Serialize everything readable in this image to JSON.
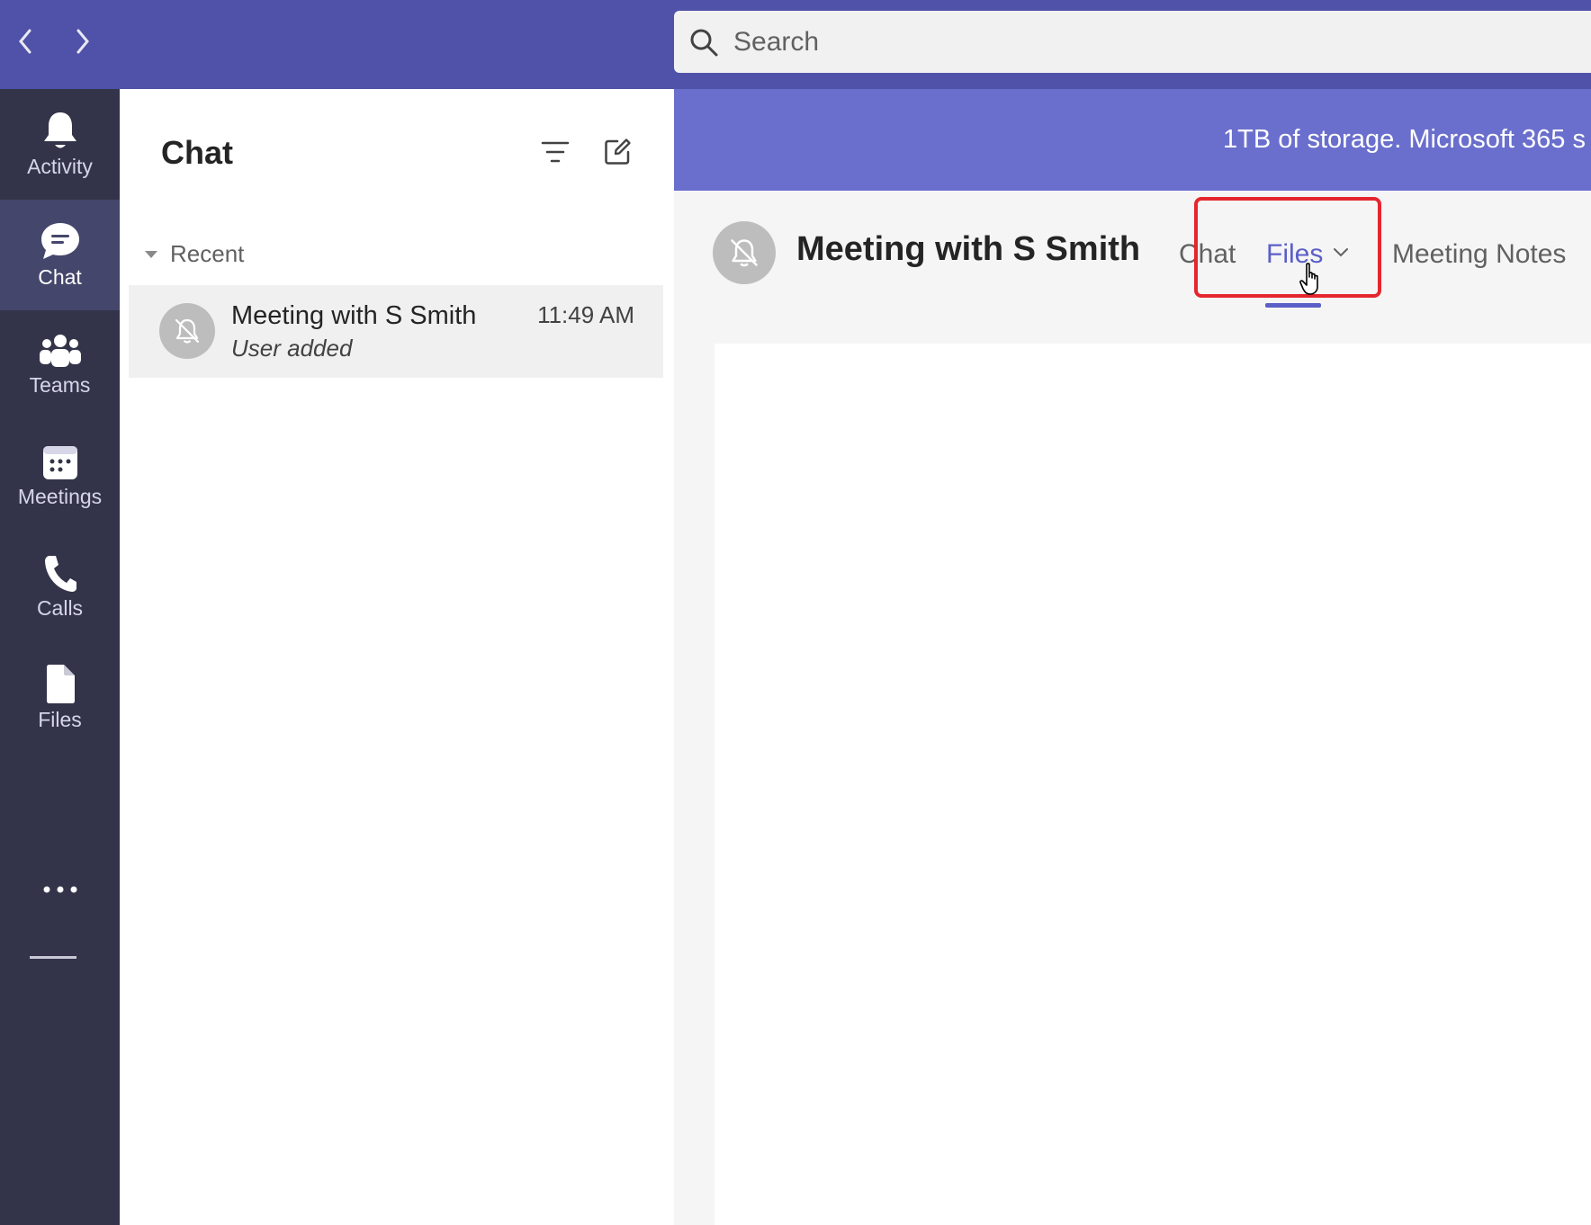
{
  "topbar": {
    "back_icon": "chevron-left-icon",
    "forward_icon": "chevron-right-icon",
    "search_placeholder": "Search"
  },
  "rail": {
    "items": [
      {
        "label": "Activity",
        "icon": "bell-icon"
      },
      {
        "label": "Chat",
        "icon": "chat-bubble-icon",
        "active": true
      },
      {
        "label": "Teams",
        "icon": "people-icon"
      },
      {
        "label": "Meetings",
        "icon": "calendar-icon"
      },
      {
        "label": "Calls",
        "icon": "phone-icon"
      },
      {
        "label": "Files",
        "icon": "file-icon"
      }
    ],
    "more_icon": "more-horizontal-icon"
  },
  "chatlist": {
    "title": "Chat",
    "section": "Recent",
    "chats": [
      {
        "name": "Meeting with S Smith",
        "time": "11:49 AM",
        "preview": "User added",
        "icon": "bell-off-icon"
      }
    ]
  },
  "banner": {
    "text": "1TB of storage. Microsoft 365 s"
  },
  "conversation": {
    "title": "Meeting with S Smith",
    "tabs": [
      {
        "label": "Chat"
      },
      {
        "label": "Files",
        "active": true
      },
      {
        "label": "Meeting Notes"
      }
    ]
  },
  "colors": {
    "topbar": "#4f52a8",
    "rail": "#33344a",
    "accent": "#5b5fc7",
    "banner": "#6a6fcd",
    "highlight": "#e5262e"
  }
}
